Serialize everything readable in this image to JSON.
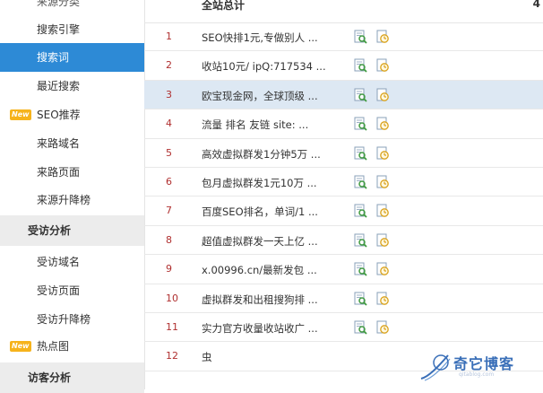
{
  "sidebar": {
    "top_clipped": "来源分类",
    "items1": [
      {
        "label": "搜索引擎",
        "active": false
      },
      {
        "label": "搜索词",
        "active": true
      },
      {
        "label": "最近搜索",
        "active": false
      },
      {
        "label": "SEO推荐",
        "active": false,
        "badge": "New"
      },
      {
        "label": "来路域名",
        "active": false
      },
      {
        "label": "来路页面",
        "active": false
      },
      {
        "label": "来源升降榜",
        "active": false
      }
    ],
    "section1": "受访分析",
    "items2": [
      {
        "label": "受访域名"
      },
      {
        "label": "受访页面"
      },
      {
        "label": "受访升降榜"
      },
      {
        "label": "热点图",
        "badge": "New"
      }
    ],
    "section2": "访客分析"
  },
  "table": {
    "header_title": "全站总计",
    "header_right": "4",
    "rows": [
      {
        "num": "1",
        "keyword": "SEO快排1元,专做别人 ..."
      },
      {
        "num": "2",
        "keyword": "收站10元/ ipQ:717534 ..."
      },
      {
        "num": "3",
        "keyword": "欧宝现金网，全球顶级 ..."
      },
      {
        "num": "4",
        "keyword": "流量 排名 友链 site: ..."
      },
      {
        "num": "5",
        "keyword": "高效虚拟群发1分钟5万 ..."
      },
      {
        "num": "6",
        "keyword": "包月虚拟群发1元10万 ..."
      },
      {
        "num": "7",
        "keyword": "百度SEO排名，单词/1 ..."
      },
      {
        "num": "8",
        "keyword": "超值虚拟群发一天上亿 ..."
      },
      {
        "num": "9",
        "keyword": "x.00996.cn/最新发包 ..."
      },
      {
        "num": "10",
        "keyword": "虚拟群发和出租搜狗排 ..."
      },
      {
        "num": "11",
        "keyword": "实力官方收量收站收广 ..."
      },
      {
        "num": "12",
        "keyword": "虫"
      }
    ]
  },
  "watermark": {
    "title": "奇它博客",
    "sub": "qitablog.com"
  },
  "colors": {
    "active_blue": "#2d8ad6",
    "new_badge": "#f6b31c",
    "row_highlight": "#dde8f3",
    "row_number": "#b03030"
  }
}
